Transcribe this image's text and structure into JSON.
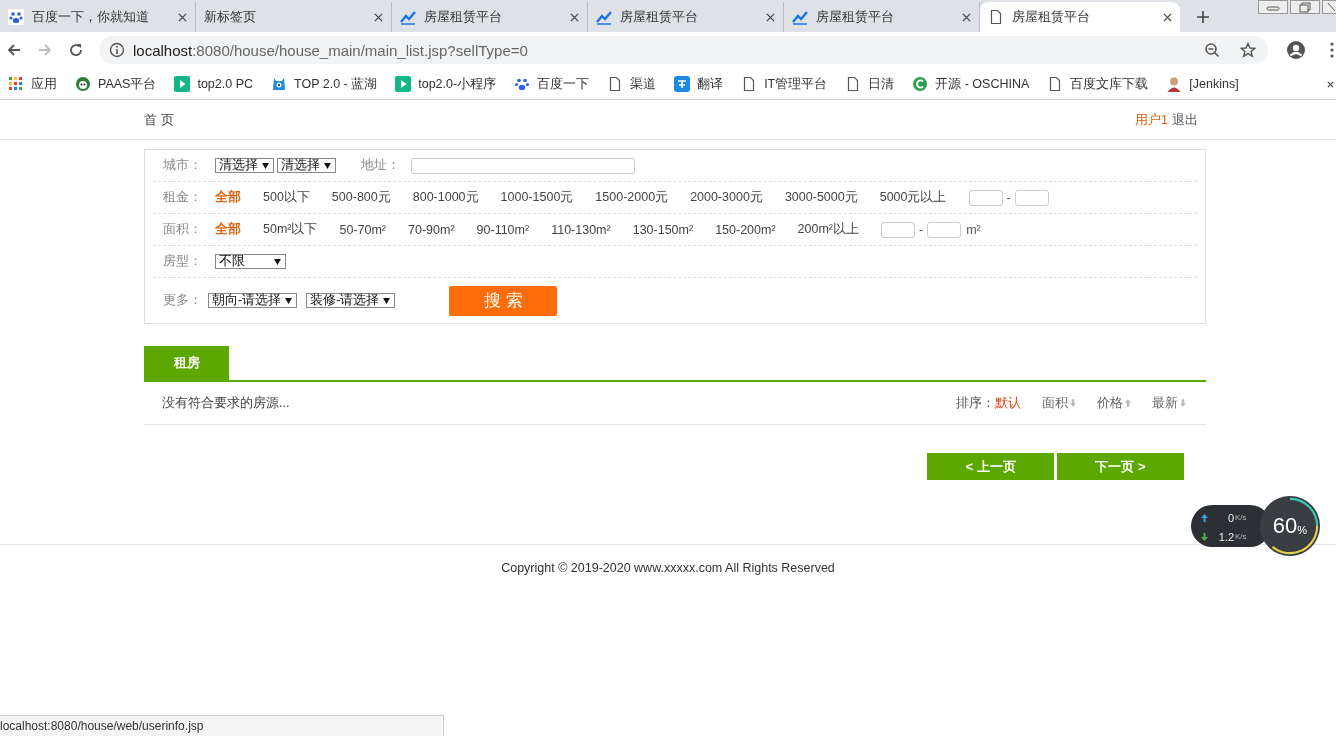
{
  "browser": {
    "tabs": [
      {
        "title": "百度一下，你就知道",
        "kind": "paw",
        "selected": false
      },
      {
        "title": "新标签页",
        "kind": "blank",
        "selected": false
      },
      {
        "title": "房屋租赁平台",
        "kind": "chart",
        "selected": false
      },
      {
        "title": "房屋租赁平台",
        "kind": "chart",
        "selected": false
      },
      {
        "title": "房屋租赁平台",
        "kind": "chart",
        "selected": false
      },
      {
        "title": "房屋租赁平台",
        "kind": "doc",
        "selected": true
      }
    ],
    "url": {
      "host": "localhost",
      "path": ":8080/house/house_main/main_list.jsp?sellType=0"
    },
    "bookmarks": [
      {
        "label": "应用",
        "kind": "grid"
      },
      {
        "label": "PAAS平台",
        "kind": "round"
      },
      {
        "label": "top2.0 PC",
        "kind": "play"
      },
      {
        "label": "TOP 2.0 - 蓝湖",
        "kind": "creature"
      },
      {
        "label": "top2.0-小程序",
        "kind": "play"
      },
      {
        "label": "百度一下",
        "kind": "paw"
      },
      {
        "label": "渠道",
        "kind": "doc"
      },
      {
        "label": "翻译",
        "kind": "translate"
      },
      {
        "label": "IT管理平台",
        "kind": "doc"
      },
      {
        "label": "日清",
        "kind": "doc"
      },
      {
        "label": "开源 - OSCHINA",
        "kind": "c"
      },
      {
        "label": "百度文库下载",
        "kind": "doc"
      },
      {
        "label": "[Jenkins]",
        "kind": "avatar"
      }
    ]
  },
  "header": {
    "home": "首 页",
    "user": "用户1",
    "logout": "退出"
  },
  "filters": [
    {
      "kind": "city",
      "label": "城市：",
      "selects": [
        "清选择",
        "清选择"
      ],
      "address_label": "地址："
    },
    {
      "kind": "options",
      "label": "租金：",
      "options": [
        {
          "text": "全部",
          "selected": true
        },
        {
          "text": "500以下",
          "selected": false
        },
        {
          "text": "500-800元",
          "selected": false
        },
        {
          "text": "800-1000元",
          "selected": false
        },
        {
          "text": "1000-1500元",
          "selected": false
        },
        {
          "text": "1500-2000元",
          "selected": false
        },
        {
          "text": "2000-3000元",
          "selected": false
        },
        {
          "text": "3000-5000元",
          "selected": false
        },
        {
          "text": "5000元以上",
          "selected": false
        }
      ],
      "separator": "-"
    },
    {
      "kind": "options",
      "label": "面积：",
      "options": [
        {
          "text": "全部",
          "selected": true
        },
        {
          "text": "50m²以下",
          "selected": false
        },
        {
          "text": "50-70m²",
          "selected": false
        },
        {
          "text": "70-90m²",
          "selected": false
        },
        {
          "text": "90-110m²",
          "selected": false
        },
        {
          "text": "110-130m²",
          "selected": false
        },
        {
          "text": "130-150m²",
          "selected": false
        },
        {
          "text": "150-200m²",
          "selected": false
        },
        {
          "text": "200m²以上",
          "selected": false
        }
      ],
      "separator": "-",
      "unit": "m²"
    },
    {
      "kind": "selects",
      "label": "房型：",
      "selects": [
        "不限"
      ]
    },
    {
      "kind": "more",
      "label": "更多：",
      "selects": [
        "朝向-请选择",
        "装修-请选择"
      ],
      "button": "搜 索"
    }
  ],
  "tabs": [
    {
      "label": "租房",
      "selected": true
    }
  ],
  "results": {
    "message": "没有符合要求的房源...",
    "sort_label": "排序：",
    "sort": [
      {
        "text": "默认",
        "selected": true,
        "kind": "plain"
      },
      {
        "text": "面积",
        "selected": false,
        "kind": "desc"
      },
      {
        "text": "价格",
        "selected": false,
        "kind": "asc"
      },
      {
        "text": "最新",
        "selected": false,
        "kind": "desc"
      }
    ]
  },
  "pager": [
    "< 上一页",
    "下一页 >"
  ],
  "footer": "Copyright © 2019-2020 www.xxxxx.com All Rights Reserved",
  "status_bar": "localhost:8080/house/web/userinfo.jsp",
  "net_widget": {
    "up": "0",
    "up_unit": "K/s",
    "down": "1.2",
    "down_unit": "K/s",
    "percent": "60",
    "percent_sign": "%"
  }
}
